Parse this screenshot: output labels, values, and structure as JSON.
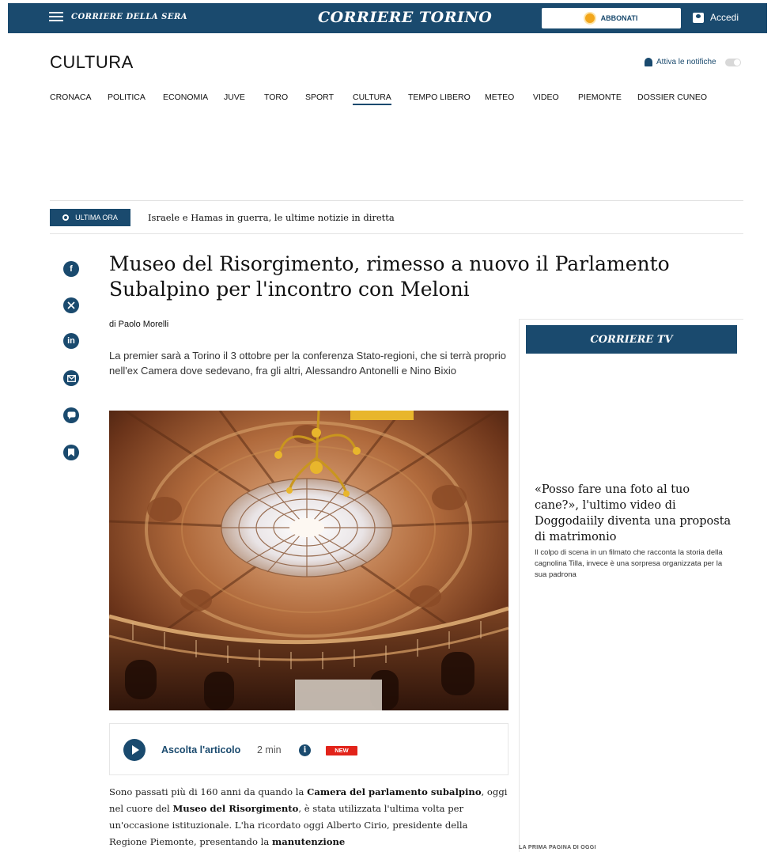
{
  "topbar": {
    "menu_logo": "CORRIERE DELLA SERA",
    "brand": "CORRIERE TORINO",
    "subscribe_label": "ABBONATI",
    "login_label": "Accedi"
  },
  "section": {
    "title": "CULTURA",
    "notifications_label": "Attiva le notifiche"
  },
  "nav": {
    "items": [
      "CRONACA",
      "POLITICA",
      "ECONOMIA",
      "JUVE",
      "TORO",
      "SPORT",
      "CULTURA",
      "TEMPO LIBERO",
      "METEO",
      "VIDEO",
      "PIEMONTE",
      "DOSSIER CUNEO"
    ],
    "active": "CULTURA"
  },
  "breaking": {
    "label": "ULTIMA ORA",
    "text": "Israele e Hamas in guerra, le ultime notizie in diretta"
  },
  "share": {
    "icons": [
      "facebook-icon",
      "x-icon",
      "linkedin-icon",
      "email-icon",
      "comment-icon",
      "bookmark-icon"
    ]
  },
  "article": {
    "headline": "Museo del Risorgimento, rimesso a nuovo il Parlamento Subalpino per l'incontro con Meloni",
    "byline": "di Paolo Morelli",
    "summary": "La premier sarà a Torino il 3 ottobre per la conferenza Stato-regioni, che si terrà proprio nell'ex Camera dove sedevano, fra gli altri, Alessandro Antonelli e Nino Bixio",
    "audio": {
      "listen_label": "Ascolta l'articolo",
      "duration": "2 min",
      "info_icon": "i",
      "badge": "NEW"
    },
    "body": {
      "p1_a": "Sono passati più di 160 anni da quando la ",
      "p1_b": "Camera del parlamento subalpino",
      "p1_c": ", oggi nel cuore del ",
      "p1_d": "Museo del Risorgimento",
      "p1_e": ", è stata utilizzata l'ultima volta per un'occasione istituzionale. L'ha ricordato oggi Alberto Cirio, presidente della Regione Piemonte, presentando la ",
      "p1_f": "manutenzione"
    }
  },
  "sidebar": {
    "header": "CORRIERE TV",
    "video_title": "«Posso fare una foto al tuo cane?», l'ultimo video di Doggodaiily diventa una proposta di matrimonio",
    "video_desc": "Il colpo di scena in un filmato che racconta la storia della cagnolina Tilla, invece è una sorpresa organizzata per la sua padrona",
    "prima_pagina": "LA PRIMA PAGINA DI OGGI"
  },
  "colors": {
    "brand_blue": "#1a4a6e",
    "new_red": "#e2231a",
    "subscribe_sun": "#f2a61b"
  }
}
